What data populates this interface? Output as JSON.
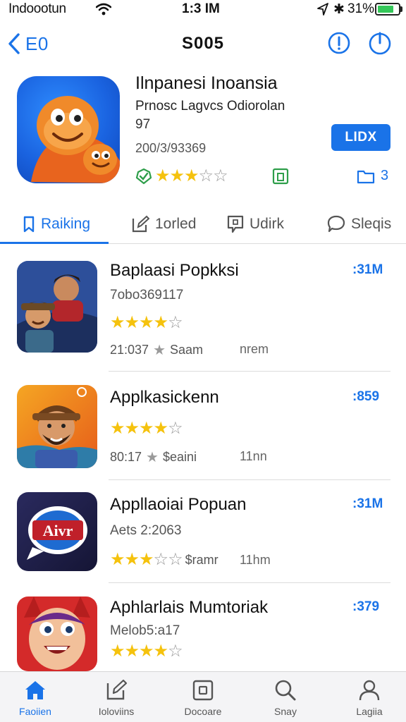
{
  "status_bar": {
    "carrier": "Indoootun",
    "time": "1:3 IM",
    "battery_pct": "31%"
  },
  "nav": {
    "back_label": "E0",
    "title": "S005",
    "icons": [
      "info-icon",
      "power-icon"
    ]
  },
  "app": {
    "title": "Ilnpanesi Inoansia",
    "developer": "Prnosc Lagvcs Odiorolan",
    "age": "97",
    "reviews": "200/3/93369",
    "rating_stars": 3,
    "get_label": "LIDX",
    "folder_count": "3",
    "colors": {
      "accent": "#1a73e8",
      "star": "#f5c20d",
      "badge_green": "#2e9e4a"
    }
  },
  "tabs": [
    {
      "label": "Raiking",
      "icon": "bookmark-icon",
      "active": true
    },
    {
      "label": "1orled",
      "icon": "edit-icon",
      "active": false
    },
    {
      "label": "Udirk",
      "icon": "note-icon",
      "active": false
    },
    {
      "label": "Sleqis",
      "icon": "chat-icon",
      "active": false
    }
  ],
  "list": [
    {
      "title": "Baplaasi Popkksi",
      "price": ":31M",
      "sub": "7obo369117",
      "stars": 4,
      "meta_num": "21:037",
      "meta_label": "Saam",
      "extra": "nrem"
    },
    {
      "title": "Applkasickenn",
      "price": ":859",
      "sub": "",
      "stars": 4,
      "meta_num": "80:17",
      "meta_label": "$eaini",
      "extra": "11nn"
    },
    {
      "title": "Appllaoiai Popuan",
      "price": ":31M",
      "sub": "Aets 2:2063",
      "stars": 3,
      "meta_num": "",
      "meta_label": "$ramr",
      "extra": "11hm"
    },
    {
      "title": "Aphlarlais Mumtoriak",
      "price": ":379",
      "sub": "Melob5:a17",
      "stars": 4,
      "meta_num": "",
      "meta_label": "",
      "extra": ""
    }
  ],
  "tabbar": [
    {
      "label": "Faoiien",
      "icon": "home-icon",
      "active": true
    },
    {
      "label": "Ioloviins",
      "icon": "compose-icon",
      "active": false
    },
    {
      "label": "Docoare",
      "icon": "square-icon",
      "active": false
    },
    {
      "label": "Snay",
      "icon": "search-icon",
      "active": false
    },
    {
      "label": "Lagiia",
      "icon": "person-icon",
      "active": false
    }
  ]
}
